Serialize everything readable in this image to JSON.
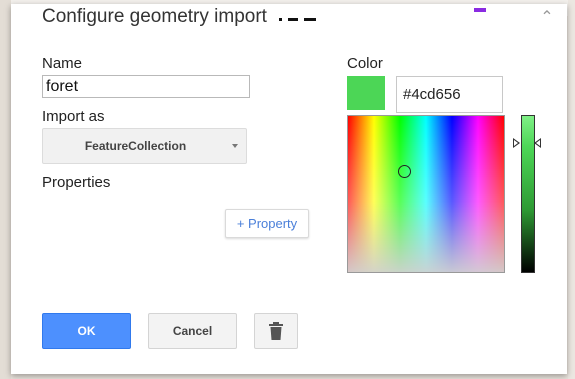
{
  "dialog": {
    "title": "Configure geometry import"
  },
  "form": {
    "name_label": "Name",
    "name_value": "foret",
    "import_as_label": "Import as",
    "import_as_value": "FeatureCollection",
    "properties_label": "Properties",
    "add_property_label": "+ Property"
  },
  "color": {
    "label": "Color",
    "hex_value": "#4cd656",
    "swatch": "#4cd656"
  },
  "actions": {
    "ok_label": "OK",
    "cancel_label": "Cancel",
    "delete_icon": "trash-icon"
  },
  "colors": {
    "primary_button": "#4d90fe",
    "link": "#4a7fd9"
  }
}
